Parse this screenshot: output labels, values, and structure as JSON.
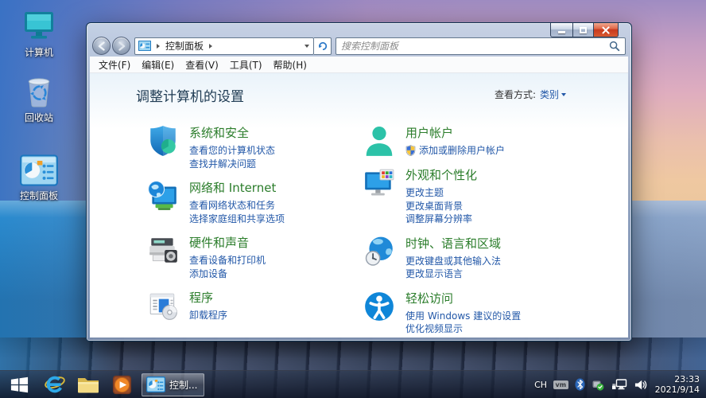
{
  "desktop_icons": [
    {
      "label": "计算机"
    },
    {
      "label": "回收站"
    },
    {
      "label": "控制面板"
    }
  ],
  "window": {
    "breadcrumb": "控制面板",
    "search_placeholder": "搜索控制面板",
    "menu": [
      "文件(F)",
      "编辑(E)",
      "查看(V)",
      "工具(T)",
      "帮助(H)"
    ],
    "page_title": "调整计算机的设置",
    "view_by_label": "查看方式:",
    "view_by_value": "类别"
  },
  "categories": {
    "left": [
      {
        "title": "系统和安全",
        "links": [
          "查看您的计算机状态",
          "查找并解决问题"
        ]
      },
      {
        "title": "网络和 Internet",
        "links": [
          "查看网络状态和任务",
          "选择家庭组和共享选项"
        ]
      },
      {
        "title": "硬件和声音",
        "links": [
          "查看设备和打印机",
          "添加设备"
        ]
      },
      {
        "title": "程序",
        "links": [
          "卸载程序"
        ]
      }
    ],
    "right": [
      {
        "title": "用户帐户",
        "links": [
          "添加或删除用户帐户"
        ]
      },
      {
        "title": "外观和个性化",
        "links": [
          "更改主题",
          "更改桌面背景",
          "调整屏幕分辨率"
        ]
      },
      {
        "title": "时钟、语言和区域",
        "links": [
          "更改键盘或其他输入法",
          "更改显示语言"
        ]
      },
      {
        "title": "轻松访问",
        "links": [
          "使用 Windows 建议的设置",
          "优化视频显示"
        ]
      }
    ]
  },
  "taskbar": {
    "active_task_label": "控制...",
    "tray": {
      "input_indicator": "CH",
      "vm_label": "vm",
      "time": "23:33",
      "date": "2021/9/14"
    }
  },
  "colors": {
    "category_title_green": "#2b7d2b",
    "link_blue": "#2358a8",
    "close_button_red": "#d04a28"
  }
}
